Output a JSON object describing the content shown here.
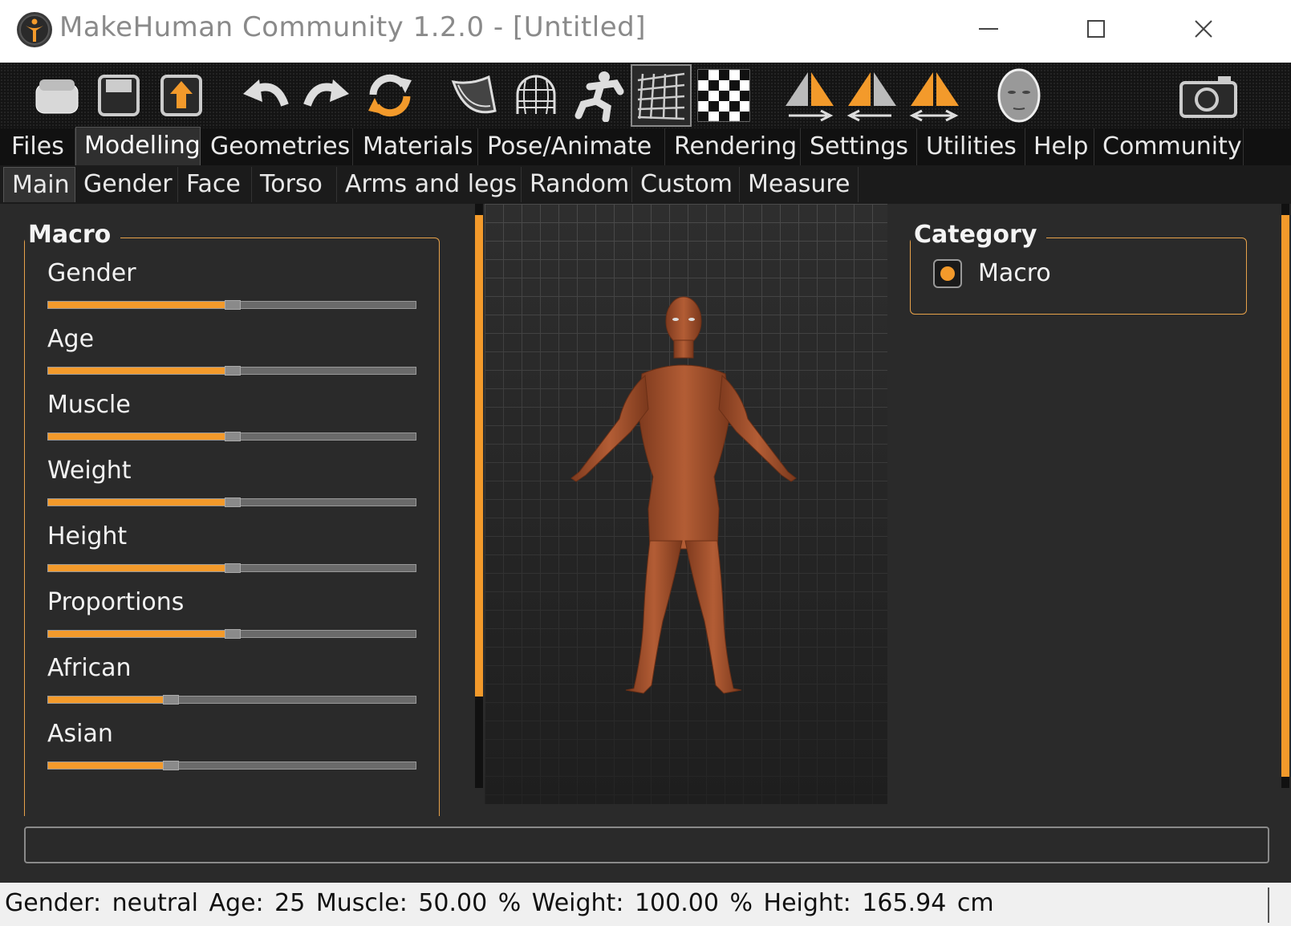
{
  "window": {
    "title": "MakeHuman Community 1.2.0 - [Untitled]",
    "minimize_icon": "minimize-icon",
    "maximize_icon": "maximize-icon",
    "close_icon": "close-icon"
  },
  "toolbar": {
    "items": [
      {
        "icon": "open-folder-icon"
      },
      {
        "icon": "save-icon"
      },
      {
        "icon": "export-icon"
      },
      {
        "icon": "undo-icon"
      },
      {
        "icon": "redo-icon"
      },
      {
        "icon": "reset-icon"
      },
      {
        "icon": "smooth-icon"
      },
      {
        "icon": "wireframe-icon"
      },
      {
        "icon": "pose-icon"
      },
      {
        "icon": "grid-icon",
        "active": true
      },
      {
        "icon": "checker-background-icon"
      },
      {
        "icon": "symmetry-right-icon"
      },
      {
        "icon": "symmetry-left-icon"
      },
      {
        "icon": "symmetry-both-icon"
      },
      {
        "icon": "face-view-icon"
      },
      {
        "icon": "camera-icon"
      }
    ]
  },
  "main_tabs": [
    "Files",
    "Modelling",
    "Geometries",
    "Materials",
    "Pose/Animate",
    "Rendering",
    "Settings",
    "Utilities",
    "Help",
    "Community"
  ],
  "main_tab_active": "Modelling",
  "sub_tabs": [
    "Main",
    "Gender",
    "Face",
    "Torso",
    "Arms and legs",
    "Random",
    "Custom",
    "Measure"
  ],
  "sub_tab_active": "Main",
  "macro": {
    "title": "Macro",
    "sliders": [
      {
        "label": "Gender",
        "value": 0.5
      },
      {
        "label": "Age",
        "value": 0.5
      },
      {
        "label": "Muscle",
        "value": 0.5
      },
      {
        "label": "Weight",
        "value": 0.5
      },
      {
        "label": "Height",
        "value": 0.5
      },
      {
        "label": "Proportions",
        "value": 0.5
      },
      {
        "label": "African",
        "value": 0.333
      },
      {
        "label": "Asian",
        "value": 0.333
      }
    ]
  },
  "category": {
    "title": "Category",
    "option_label": "Macro",
    "selected": true
  },
  "command_input": {
    "value": ""
  },
  "status": {
    "text": "Gender: neutral   Age: 25   Muscle: 50.00 %   Weight: 100.00 %   Height: 165.94 cm"
  },
  "colors": {
    "accent": "#f39a2b",
    "panel_bg": "#2a2a2a",
    "toolbar_bg": "#141414",
    "skin": "#a4532f"
  }
}
